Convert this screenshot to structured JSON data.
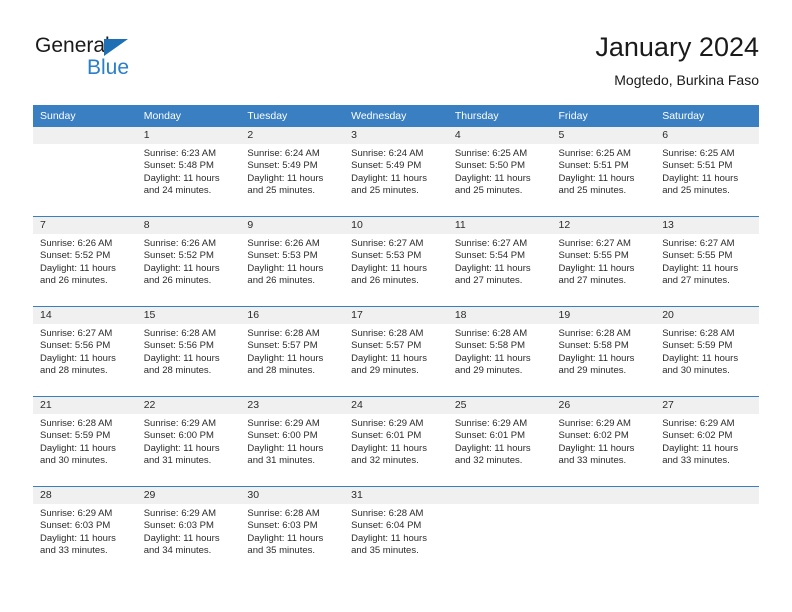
{
  "branding": {
    "logo_primary": "General",
    "logo_secondary": "Blue",
    "logo_triangle_icon": "triangle-icon",
    "primary_color": "#2a7fc9",
    "header_color": "#3a7fc1"
  },
  "header": {
    "title": "January 2024",
    "subtitle": "Mogtedo, Burkina Faso"
  },
  "weekdays": [
    "Sunday",
    "Monday",
    "Tuesday",
    "Wednesday",
    "Thursday",
    "Friday",
    "Saturday"
  ],
  "labels": {
    "sunrise_prefix": "Sunrise:",
    "sunset_prefix": "Sunset:",
    "daylight_prefix": "Daylight:"
  },
  "weeks": [
    [
      {
        "day": "",
        "sunrise": "",
        "sunset": "",
        "daylight_1": "",
        "daylight_2": ""
      },
      {
        "day": "1",
        "sunrise": "Sunrise: 6:23 AM",
        "sunset": "Sunset: 5:48 PM",
        "daylight_1": "Daylight: 11 hours",
        "daylight_2": "and 24 minutes."
      },
      {
        "day": "2",
        "sunrise": "Sunrise: 6:24 AM",
        "sunset": "Sunset: 5:49 PM",
        "daylight_1": "Daylight: 11 hours",
        "daylight_2": "and 25 minutes."
      },
      {
        "day": "3",
        "sunrise": "Sunrise: 6:24 AM",
        "sunset": "Sunset: 5:49 PM",
        "daylight_1": "Daylight: 11 hours",
        "daylight_2": "and 25 minutes."
      },
      {
        "day": "4",
        "sunrise": "Sunrise: 6:25 AM",
        "sunset": "Sunset: 5:50 PM",
        "daylight_1": "Daylight: 11 hours",
        "daylight_2": "and 25 minutes."
      },
      {
        "day": "5",
        "sunrise": "Sunrise: 6:25 AM",
        "sunset": "Sunset: 5:51 PM",
        "daylight_1": "Daylight: 11 hours",
        "daylight_2": "and 25 minutes."
      },
      {
        "day": "6",
        "sunrise": "Sunrise: 6:25 AM",
        "sunset": "Sunset: 5:51 PM",
        "daylight_1": "Daylight: 11 hours",
        "daylight_2": "and 25 minutes."
      }
    ],
    [
      {
        "day": "7",
        "sunrise": "Sunrise: 6:26 AM",
        "sunset": "Sunset: 5:52 PM",
        "daylight_1": "Daylight: 11 hours",
        "daylight_2": "and 26 minutes."
      },
      {
        "day": "8",
        "sunrise": "Sunrise: 6:26 AM",
        "sunset": "Sunset: 5:52 PM",
        "daylight_1": "Daylight: 11 hours",
        "daylight_2": "and 26 minutes."
      },
      {
        "day": "9",
        "sunrise": "Sunrise: 6:26 AM",
        "sunset": "Sunset: 5:53 PM",
        "daylight_1": "Daylight: 11 hours",
        "daylight_2": "and 26 minutes."
      },
      {
        "day": "10",
        "sunrise": "Sunrise: 6:27 AM",
        "sunset": "Sunset: 5:53 PM",
        "daylight_1": "Daylight: 11 hours",
        "daylight_2": "and 26 minutes."
      },
      {
        "day": "11",
        "sunrise": "Sunrise: 6:27 AM",
        "sunset": "Sunset: 5:54 PM",
        "daylight_1": "Daylight: 11 hours",
        "daylight_2": "and 27 minutes."
      },
      {
        "day": "12",
        "sunrise": "Sunrise: 6:27 AM",
        "sunset": "Sunset: 5:55 PM",
        "daylight_1": "Daylight: 11 hours",
        "daylight_2": "and 27 minutes."
      },
      {
        "day": "13",
        "sunrise": "Sunrise: 6:27 AM",
        "sunset": "Sunset: 5:55 PM",
        "daylight_1": "Daylight: 11 hours",
        "daylight_2": "and 27 minutes."
      }
    ],
    [
      {
        "day": "14",
        "sunrise": "Sunrise: 6:27 AM",
        "sunset": "Sunset: 5:56 PM",
        "daylight_1": "Daylight: 11 hours",
        "daylight_2": "and 28 minutes."
      },
      {
        "day": "15",
        "sunrise": "Sunrise: 6:28 AM",
        "sunset": "Sunset: 5:56 PM",
        "daylight_1": "Daylight: 11 hours",
        "daylight_2": "and 28 minutes."
      },
      {
        "day": "16",
        "sunrise": "Sunrise: 6:28 AM",
        "sunset": "Sunset: 5:57 PM",
        "daylight_1": "Daylight: 11 hours",
        "daylight_2": "and 28 minutes."
      },
      {
        "day": "17",
        "sunrise": "Sunrise: 6:28 AM",
        "sunset": "Sunset: 5:57 PM",
        "daylight_1": "Daylight: 11 hours",
        "daylight_2": "and 29 minutes."
      },
      {
        "day": "18",
        "sunrise": "Sunrise: 6:28 AM",
        "sunset": "Sunset: 5:58 PM",
        "daylight_1": "Daylight: 11 hours",
        "daylight_2": "and 29 minutes."
      },
      {
        "day": "19",
        "sunrise": "Sunrise: 6:28 AM",
        "sunset": "Sunset: 5:58 PM",
        "daylight_1": "Daylight: 11 hours",
        "daylight_2": "and 29 minutes."
      },
      {
        "day": "20",
        "sunrise": "Sunrise: 6:28 AM",
        "sunset": "Sunset: 5:59 PM",
        "daylight_1": "Daylight: 11 hours",
        "daylight_2": "and 30 minutes."
      }
    ],
    [
      {
        "day": "21",
        "sunrise": "Sunrise: 6:28 AM",
        "sunset": "Sunset: 5:59 PM",
        "daylight_1": "Daylight: 11 hours",
        "daylight_2": "and 30 minutes."
      },
      {
        "day": "22",
        "sunrise": "Sunrise: 6:29 AM",
        "sunset": "Sunset: 6:00 PM",
        "daylight_1": "Daylight: 11 hours",
        "daylight_2": "and 31 minutes."
      },
      {
        "day": "23",
        "sunrise": "Sunrise: 6:29 AM",
        "sunset": "Sunset: 6:00 PM",
        "daylight_1": "Daylight: 11 hours",
        "daylight_2": "and 31 minutes."
      },
      {
        "day": "24",
        "sunrise": "Sunrise: 6:29 AM",
        "sunset": "Sunset: 6:01 PM",
        "daylight_1": "Daylight: 11 hours",
        "daylight_2": "and 32 minutes."
      },
      {
        "day": "25",
        "sunrise": "Sunrise: 6:29 AM",
        "sunset": "Sunset: 6:01 PM",
        "daylight_1": "Daylight: 11 hours",
        "daylight_2": "and 32 minutes."
      },
      {
        "day": "26",
        "sunrise": "Sunrise: 6:29 AM",
        "sunset": "Sunset: 6:02 PM",
        "daylight_1": "Daylight: 11 hours",
        "daylight_2": "and 33 minutes."
      },
      {
        "day": "27",
        "sunrise": "Sunrise: 6:29 AM",
        "sunset": "Sunset: 6:02 PM",
        "daylight_1": "Daylight: 11 hours",
        "daylight_2": "and 33 minutes."
      }
    ],
    [
      {
        "day": "28",
        "sunrise": "Sunrise: 6:29 AM",
        "sunset": "Sunset: 6:03 PM",
        "daylight_1": "Daylight: 11 hours",
        "daylight_2": "and 33 minutes."
      },
      {
        "day": "29",
        "sunrise": "Sunrise: 6:29 AM",
        "sunset": "Sunset: 6:03 PM",
        "daylight_1": "Daylight: 11 hours",
        "daylight_2": "and 34 minutes."
      },
      {
        "day": "30",
        "sunrise": "Sunrise: 6:28 AM",
        "sunset": "Sunset: 6:03 PM",
        "daylight_1": "Daylight: 11 hours",
        "daylight_2": "and 35 minutes."
      },
      {
        "day": "31",
        "sunrise": "Sunrise: 6:28 AM",
        "sunset": "Sunset: 6:04 PM",
        "daylight_1": "Daylight: 11 hours",
        "daylight_2": "and 35 minutes."
      },
      {
        "day": "",
        "sunrise": "",
        "sunset": "",
        "daylight_1": "",
        "daylight_2": ""
      },
      {
        "day": "",
        "sunrise": "",
        "sunset": "",
        "daylight_1": "",
        "daylight_2": ""
      },
      {
        "day": "",
        "sunrise": "",
        "sunset": "",
        "daylight_1": "",
        "daylight_2": ""
      }
    ]
  ]
}
